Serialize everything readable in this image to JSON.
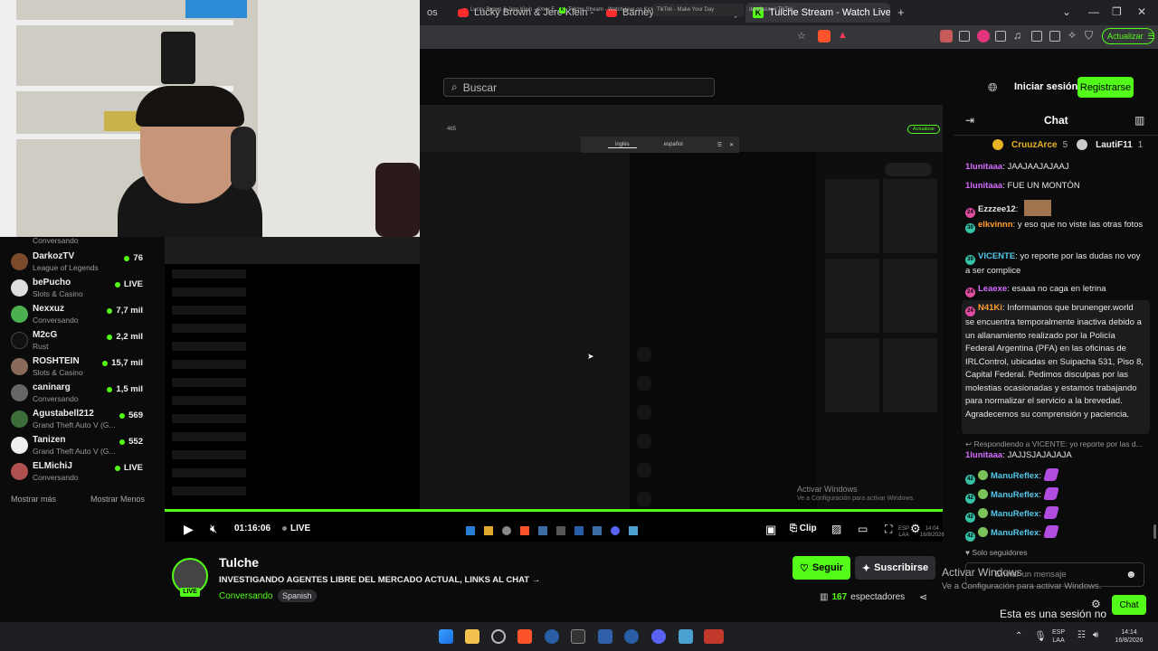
{
  "browser": {
    "tabs": [
      {
        "label": "os"
      },
      {
        "label": "Lucky Brown & Jere Klein - Amor Esc"
      },
      {
        "label": "Barney - El Nuevo Chico y Visita del ."
      },
      {
        "label": "Tulche Stream - Watch Live on Ki"
      }
    ],
    "new_tab": "+",
    "update_label": "Actualizar",
    "window_controls": [
      "⌄",
      "—",
      "❐",
      "✕"
    ]
  },
  "header": {
    "search_placeholder": "Buscar",
    "login": "Iniciar sesión",
    "register": "Registrarse"
  },
  "sidebar": {
    "partial_category": "Conversando",
    "channels": [
      {
        "name": "DarkozTV",
        "category": "League of Legends",
        "viewers": "76"
      },
      {
        "name": "bePucho",
        "category": "Slots & Casino",
        "viewers": "LIVE"
      },
      {
        "name": "Nexxuz",
        "category": "Conversando",
        "viewers": "7,7 mil"
      },
      {
        "name": "M2cG",
        "category": "Rust",
        "viewers": "2,2 mil"
      },
      {
        "name": "ROSHTEIN",
        "category": "Slots & Casino",
        "viewers": "15,7 mil"
      },
      {
        "name": "caninarg",
        "category": "Conversando",
        "viewers": "1,5 mil"
      },
      {
        "name": "Agustabell212",
        "category": "Grand Theft Auto V (G...",
        "viewers": "569"
      },
      {
        "name": "Tanizen",
        "category": "Grand Theft Auto V (G...",
        "viewers": "552"
      },
      {
        "name": "ELMichiJ",
        "category": "Conversando",
        "viewers": "LIVE"
      }
    ],
    "show_more": "Mostrar más",
    "show_less": "Mostrar Menos"
  },
  "inner_screen": {
    "tabs": [
      "Lucky Brown & Jere Klein - Amor E...",
      "Tulche Stream - Watch Live on Kick",
      "TikTok - Make Your Day",
      "detallesso | TikTok"
    ],
    "update": "Actualizar",
    "lang_a": "inglés",
    "lang_b": "español",
    "url_fragment": "465"
  },
  "player": {
    "time": "01:16:06",
    "live": "LIVE",
    "clip": "Clip",
    "win_activate_1": "Activar Windows",
    "win_activate_2": "Ve a Configuración para activar Windows.",
    "inner_clock_1": "ESP",
    "inner_clock_2": "LAA",
    "inner_time": "14:04",
    "inner_date": "16/8/2026"
  },
  "stream": {
    "streamer": "Tulche",
    "title": "INVESTIGANDO AGENTES LIBRE DEL MERCADO ACTUAL, LINKS AL CHAT →",
    "category": "Conversando",
    "language": "Spanish",
    "live_badge": "LIVE",
    "follow": "Seguir",
    "subscribe": "Suscribirse",
    "viewers": "167",
    "viewers_label": "espectadores"
  },
  "chat": {
    "title": "Chat",
    "top_gifters": [
      {
        "name": "CruuzArce",
        "count": "5"
      },
      {
        "name": "LautiF11",
        "count": "1"
      }
    ],
    "messages": [
      {
        "user": "1lunitaaa",
        "text": "JAAJAAJAJAAJ"
      },
      {
        "user": "1lunitaaa",
        "text": "FUE UN MONTÓN"
      },
      {
        "user": "Ezzzee12",
        "text": "",
        "badge": "24"
      },
      {
        "user": "elkvinnn",
        "text": "y eso que no viste las otras fotos",
        "badge": "30"
      },
      {
        "user": "VICENTE",
        "text": "yo reporte por las dudas no voy a ser complice",
        "badge": "39"
      },
      {
        "user": "Leaexe",
        "text": "esaaa no caga en letrina",
        "badge": "24"
      }
    ],
    "pinned": {
      "user": "N41Ki",
      "badge": "24",
      "text": "Informamos que brunenger.world se encuentra temporalmente inactiva debido a un allanamiento realizado por la Policía Federal Argentina (PFA) en las oficinas de IRLControl, ubicadas en Suipacha 531, Piso 8, Capital Federal. Pedimos disculpas por las molestias ocasionadas y estamos trabajando para normalizar el servicio a la brevedad. Agradecemos su comprensión y paciencia."
    },
    "reply_note": "Respondiendo a VICENTE: yo reporte por las d...",
    "reply": {
      "user": "1lunitaaa",
      "text": "JAJJSJAJAJAJA"
    },
    "emote_messages": [
      {
        "user": "ManuReflex",
        "badge": "42"
      },
      {
        "user": "ManuReflex",
        "badge": "42"
      },
      {
        "user": "ManuReflex",
        "badge": "42"
      },
      {
        "user": "ManuReflex",
        "badge": "42"
      }
    ],
    "followers_only": "Solo seguidores",
    "input_placeholder": "Enviar un mensaje",
    "send": "Chat"
  },
  "os_overlay": {
    "activate_1": "Activar Windows",
    "activate_2": "Ve a Configuración para activar Windows.",
    "no_session": "Esta es una sesión no comercial."
  },
  "taskbar": {
    "lang_1": "ESP",
    "lang_2": "LAA",
    "time": "14:14",
    "date": "16/8/2026"
  },
  "colors": {
    "accent": "#53fc18",
    "background": "#0b0b0c"
  }
}
